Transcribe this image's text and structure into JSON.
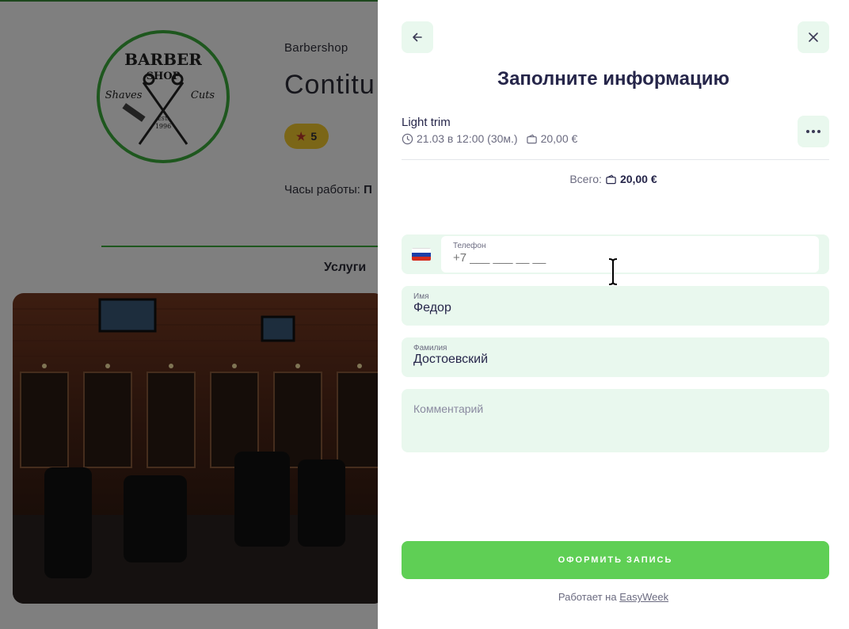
{
  "background": {
    "category": "Barbershop",
    "title": "Contitu",
    "rating": "5",
    "hours_label": "Часы работы:",
    "hours_value": "П",
    "tab": "Услуги",
    "logo_text": {
      "top": "BARBER",
      "middle": "SHOP",
      "left": "Shaves",
      "right": "Cuts",
      "est": "EST.",
      "year": "1996"
    }
  },
  "panel": {
    "title": "Заполните информацию",
    "service": {
      "name": "Light trim",
      "datetime": "21.03 в 12:00 (30м.)",
      "price": "20,00 €"
    },
    "total": {
      "label": "Всего:",
      "value": "20,00 €"
    },
    "phone": {
      "label": "Телефон",
      "placeholder": "+7 ___ ___ __ __",
      "country_colors": [
        "#ffffff",
        "#1c3fa8",
        "#d52b1e"
      ]
    },
    "first_name": {
      "label": "Имя",
      "value": "Федор"
    },
    "last_name": {
      "label": "Фамилия",
      "value": "Достоевский"
    },
    "comment": {
      "placeholder": "Комментарий"
    },
    "submit_label": "ОФОРМИТЬ ЗАПИСЬ",
    "footer": {
      "text": "Работает на",
      "link": "EasyWeek"
    }
  },
  "icons": {
    "back": "arrow-left-icon",
    "close": "close-icon",
    "more": "more-horizontal-icon",
    "clock": "clock-icon",
    "wallet": "wallet-icon",
    "star": "star-icon"
  },
  "colors": {
    "accent": "#5fcf55",
    "field_bg": "#e9f8ee",
    "title": "#26264a",
    "rating_badge": "#f7cc2e"
  }
}
